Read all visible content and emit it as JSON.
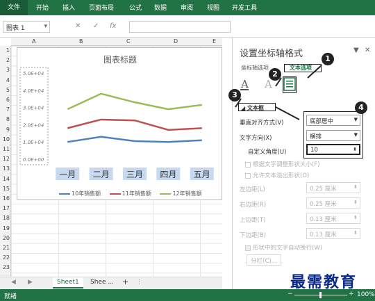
{
  "ribbon": {
    "file_tab": "文件",
    "tabs": [
      "开始",
      "插入",
      "页面布局",
      "公式",
      "数据",
      "审阅",
      "视图",
      "开发工具"
    ]
  },
  "formula_bar": {
    "name_box": "图表 1",
    "cancel_icon": "✕",
    "enter_icon": "✓",
    "fx_label": "fx"
  },
  "grid": {
    "columns": [
      "A",
      "B",
      "C",
      "D",
      "E"
    ],
    "rows": [
      "1",
      "2",
      "3",
      "4",
      "5",
      "6",
      "7",
      "8",
      "9",
      "10",
      "11",
      "12",
      "13",
      "14",
      "15",
      "16",
      "17",
      "18",
      "19",
      "20",
      "21",
      "22",
      "23"
    ]
  },
  "chart_data": {
    "type": "line",
    "title": "图表标题",
    "categories": [
      "一月",
      "二月",
      "三月",
      "四月",
      "五月"
    ],
    "y_tick_labels": [
      "5.0E+04",
      "4.0E+04",
      "3.0E+04",
      "2.0E+04",
      "1.0E+04",
      "0.0E+00"
    ],
    "ylim": [
      0,
      50000
    ],
    "series": [
      {
        "name": "10年销售额",
        "color": "#4f81bd",
        "values": [
          10000,
          13000,
          10500,
          10000,
          11000
        ]
      },
      {
        "name": "11年销售额",
        "color": "#c0504d",
        "values": [
          18000,
          23000,
          22500,
          17000,
          18000
        ]
      },
      {
        "name": "12年销售额",
        "color": "#9bbb59",
        "values": [
          29000,
          38000,
          33000,
          29000,
          31500
        ]
      }
    ],
    "legend_position": "bottom"
  },
  "sheet_tabs": {
    "nav_left": "◀",
    "nav_right": "▶",
    "tabs": [
      "Sheet1",
      "Shee ..."
    ],
    "add_icon": "+",
    "more": "⋮"
  },
  "status_bar": {
    "status": "就绪",
    "zoom": "100%",
    "zoom_minus": "−",
    "zoom_plus": "+"
  },
  "panel": {
    "title": "设置坐标轴格式",
    "collapse_icon": "▼",
    "close_icon": "✕",
    "tabs": {
      "axis_options": "坐标轴选项",
      "text_options": "文本选项"
    },
    "section": "文本框",
    "vertical_align_label": "垂直对齐方式(V)",
    "vertical_align_value": "底部居中",
    "text_direction_label": "文字方向(X)",
    "text_direction_value": "横排",
    "custom_angle_label": "自定义角度(U)",
    "custom_angle_value": "10",
    "resize_shape": "根据文字调整形状大小(F)",
    "allow_overflow": "允许文本溢出形状(O)",
    "left_margin_label": "左边距(L)",
    "left_margin_value": "0.25 厘米",
    "right_margin_label": "右边距(R)",
    "right_margin_value": "0.25 厘米",
    "top_margin_label": "上边距(T)",
    "top_margin_value": "0.13 厘米",
    "bottom_margin_label": "下边距(B)",
    "bottom_margin_value": "0.13 厘米",
    "wrap_text": "形状中的文字自动换行(W)",
    "columns_button": "分栏(C)..."
  },
  "callouts": [
    "1",
    "2",
    "3",
    "4"
  ],
  "watermark": "最需教育",
  "colors": {
    "ribbon": "#217346",
    "accent_green": "#217346"
  }
}
